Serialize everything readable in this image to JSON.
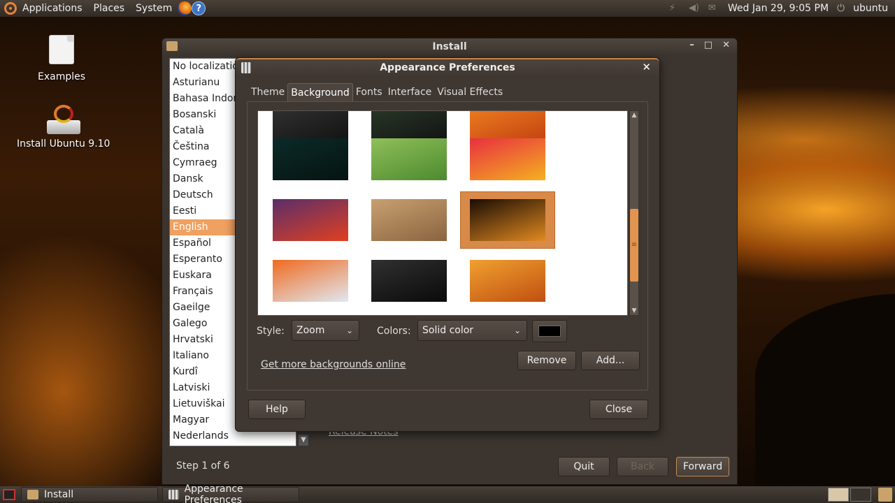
{
  "top_panel": {
    "menus": [
      "Applications",
      "Places",
      "System"
    ],
    "clock": "Wed Jan 29,  9:05 PM",
    "user": "ubuntu"
  },
  "desktop": {
    "icons": [
      {
        "label": "Examples",
        "icon": "document-icon"
      },
      {
        "label": "Install Ubuntu 9.10",
        "icon": "installer-icon"
      }
    ]
  },
  "install_window": {
    "title": "Install",
    "languages": [
      "No localization",
      "Asturianu",
      "Bahasa Indonesia",
      "Bosanski",
      "Català",
      "Čeština",
      "Cymraeg",
      "Dansk",
      "Deutsch",
      "Eesti",
      "English",
      "Español",
      "Esperanto",
      "Euskara",
      "Français",
      "Gaeilge",
      "Galego",
      "Hrvatski",
      "Italiano",
      "Kurdî",
      "Latviski",
      "Lietuviškai",
      "Magyar",
      "Nederlands"
    ],
    "selected_language": "English",
    "release_notes": "Release Notes",
    "step": "Step 1 of 6",
    "buttons": {
      "quit": "Quit",
      "back": "Back",
      "forward": "Forward"
    }
  },
  "appearance_dialog": {
    "title": "Appearance Preferences",
    "tabs": [
      "Theme",
      "Background",
      "Fonts",
      "Interface",
      "Visual Effects"
    ],
    "active_tab": "Background",
    "style_label": "Style:",
    "style_value": "Zoom",
    "colors_label": "Colors:",
    "colors_value": "Solid color",
    "swatch_color": "#000000",
    "more_link": "Get more backgrounds online",
    "buttons": {
      "remove": "Remove",
      "add": "Add...",
      "help": "Help",
      "close": "Close"
    },
    "wallpapers": [
      {
        "name": "partial-dark",
        "colors": [
          "#333",
          "#111"
        ]
      },
      {
        "name": "partial-dark-2",
        "colors": [
          "#2a3a2a",
          "#111"
        ]
      },
      {
        "name": "partial-orange",
        "colors": [
          "#f08020",
          "#c04010"
        ]
      },
      {
        "name": "water-light",
        "colors": [
          "#0c2a28",
          "#051412"
        ]
      },
      {
        "name": "green-leaf",
        "colors": [
          "#8fbf5a",
          "#4d8a2e"
        ]
      },
      {
        "name": "red-flowers",
        "colors": [
          "#e83040",
          "#f4b020"
        ]
      },
      {
        "name": "purple-sunset",
        "colors": [
          "#5a2e6a",
          "#e04020"
        ]
      },
      {
        "name": "sand-dunes",
        "colors": [
          "#c8a070",
          "#8a6440"
        ]
      },
      {
        "name": "dark-sunset",
        "colors": [
          "#1a0c04",
          "#e08a20"
        ],
        "selected": true
      },
      {
        "name": "abstract-colors",
        "colors": [
          "#f06a20",
          "#e0e8f0"
        ]
      },
      {
        "name": "dark-sparkles",
        "colors": [
          "#303030",
          "#0a0a0a"
        ]
      },
      {
        "name": "warm-glow",
        "colors": [
          "#f0a030",
          "#c05010"
        ]
      }
    ]
  },
  "bottom_panel": {
    "tasks": [
      {
        "label": "Install"
      },
      {
        "label": "Appearance Preferences"
      }
    ]
  }
}
